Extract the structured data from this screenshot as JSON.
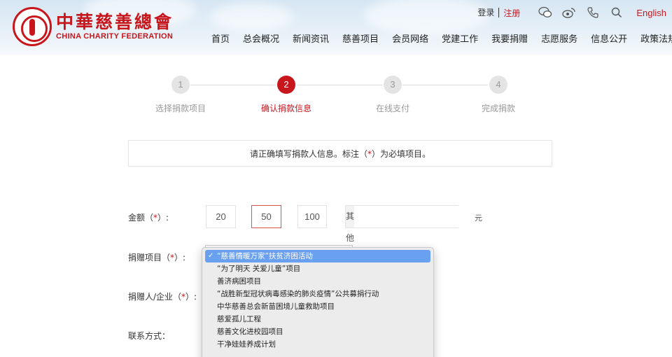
{
  "header": {
    "logo_cn": "中華慈善總會",
    "logo_en": "CHINA CHARITY FEDERATION",
    "login": "登录",
    "register": "注册",
    "language": "English",
    "icons": [
      "wechat-icon",
      "weibo-icon",
      "phone-icon",
      "search-icon"
    ],
    "nav": [
      "首页",
      "总会概况",
      "新闻资讯",
      "慈善项目",
      "会员网络",
      "党建工作",
      "我要捐赠",
      "志愿服务",
      "信息公开",
      "政策法规"
    ]
  },
  "steps": [
    {
      "num": "1",
      "label": "选择捐款项目"
    },
    {
      "num": "2",
      "label": "确认捐款信息"
    },
    {
      "num": "3",
      "label": "在线支付"
    },
    {
      "num": "4",
      "label": "完成捐款"
    }
  ],
  "active_step": 2,
  "notice": {
    "before": "请正确填写捐款人信息。标注（",
    "mark": "*",
    "after": "）为必填项目。"
  },
  "form": {
    "amount_label": "金额（",
    "amount_label_end": "）:",
    "amounts": [
      "20",
      "50",
      "100"
    ],
    "selected_amount": "50",
    "other_label": "其他",
    "unit": "元",
    "project_label": "捐赠项目（",
    "project_label_end": "）:",
    "donor_label": "捐赠人/企业（",
    "donor_label_end": "）:",
    "contact_label": "联系方式：",
    "required_mark": "*"
  },
  "dropdown": {
    "check": "✓",
    "options": [
      "“慈善情暖万家”扶贫济困活动",
      "“为了明天 关爱儿童”项目",
      "善济病困项目",
      "“战胜新型冠状病毒感染的肺炎疫情”公共募捐行动",
      "中华慈善总会新苗困境儿童救助项目",
      "慈爱孤儿工程",
      "慈善文化进校园项目",
      "干净娃娃养成计划"
    ],
    "selected_index": 0
  },
  "colors": {
    "brand_red": "#c8161d",
    "selection_blue": "#6aa0f0"
  }
}
